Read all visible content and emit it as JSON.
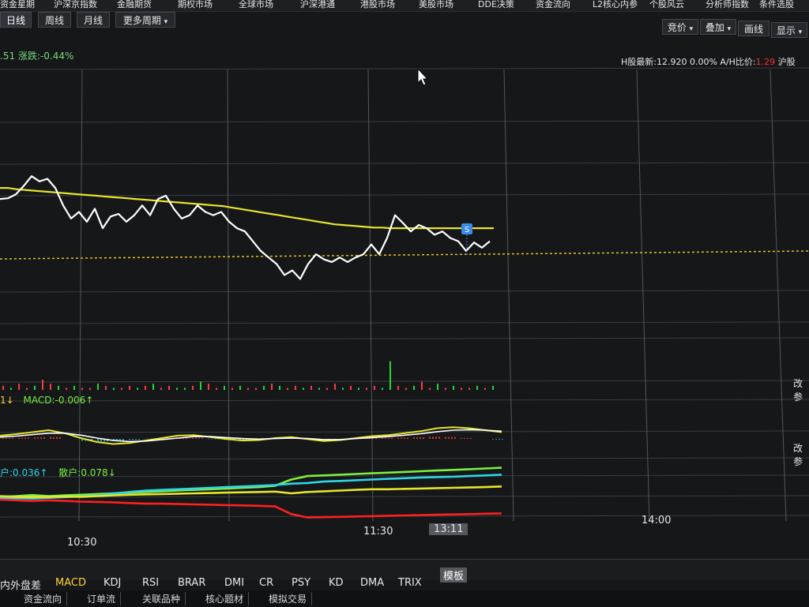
{
  "menu": {
    "items": [
      "资金星期",
      "沪深京指数",
      "金融期货",
      "期权市场",
      "全球市场",
      "沪深港通",
      "港股市场",
      "美股市场",
      "DDE决策",
      "资金流向",
      "L2核心内参",
      "个股风云",
      "分析师指数",
      "条件选股"
    ]
  },
  "period_buttons": [
    "日线",
    "周线",
    "月线",
    "更多周期"
  ],
  "tool_buttons": [
    "竞价",
    "叠加",
    "画线",
    "显示"
  ],
  "price_info": {
    "left_value": ".51",
    "change_label": "涨跌:-0.44%",
    "h_share": "H股最新:12.920",
    "h_change": "0.00%",
    "ah_label": "A/H比价:",
    "ah_value": "1.29",
    "market": "沪股"
  },
  "indicators": {
    "macd_label": "MACD:-0.006",
    "macd_prefix": "1",
    "fund_a": "户:0.036",
    "fund_b": "散户:0.078",
    "side_label_1": "改参",
    "side_label_2": "改参"
  },
  "marker": {
    "label": "S"
  },
  "time_axis": {
    "labels": [
      "10:30",
      "11:30",
      "13:11",
      "14:00"
    ]
  },
  "bottom_tabs": [
    "内外盘差",
    "MACD",
    "KDJ",
    "RSI",
    "BRAR",
    "DMI",
    "CR",
    "PSY",
    "KD",
    "DMA",
    "TRIX",
    "模板"
  ],
  "bottom_bar2": [
    "资金流向",
    "订单流",
    "关联品种",
    "核心题材",
    "模拟交易"
  ],
  "colors": {
    "background": "#151719",
    "price_line": "#ffffff",
    "avg_line": "#e6e62a",
    "up": "#ff3b3b",
    "down": "#26d43b",
    "fund_green": "#7cf040",
    "fund_cyan": "#2fd6e6",
    "fund_yellow": "#e6e62a",
    "fund_red": "#ff2020"
  },
  "chart_data": [
    {
      "type": "line",
      "x": [
        0,
        10,
        20,
        30,
        40,
        50,
        60,
        70,
        80,
        90,
        100,
        110,
        120,
        130,
        140,
        150,
        160,
        170,
        180,
        190,
        200,
        210,
        220,
        230,
        240,
        250,
        260,
        270,
        280,
        290,
        300,
        310,
        320,
        330,
        340,
        350,
        360,
        370,
        380,
        390,
        400,
        410,
        420,
        430,
        440,
        450,
        460,
        470,
        480,
        490,
        500,
        510,
        520,
        530,
        540,
        550,
        560,
        570,
        580,
        590,
        600,
        610,
        620
      ],
      "series": [
        {
          "values": [
            0.55,
            0.56,
            0.62,
            0.75,
            0.9,
            0.82,
            0.86,
            0.72,
            0.45,
            0.25,
            0.35,
            0.2,
            0.4,
            0.1,
            0.28,
            0.32,
            0.2,
            0.3,
            0.45,
            0.3,
            0.55,
            0.6,
            0.4,
            0.25,
            0.3,
            0.45,
            0.35,
            0.3,
            0.35,
            0.2,
            0.1,
            0.05,
            -0.1,
            -0.25,
            -0.35,
            -0.45,
            -0.62,
            -0.55,
            -0.68,
            -0.45,
            -0.3,
            -0.38,
            -0.42,
            -0.35,
            -0.42,
            -0.35,
            -0.3,
            -0.15,
            -0.3,
            -0.05,
            0.3,
            0.18,
            0.05,
            0.15,
            0.1,
            0.0,
            0.05,
            -0.05,
            -0.1,
            -0.25,
            -0.12,
            -0.2,
            -0.1
          ]
        },
        {
          "values": [
            0.72,
            0.72,
            0.7,
            0.69,
            0.68,
            0.67,
            0.66,
            0.65,
            0.64,
            0.63,
            0.62,
            0.61,
            0.6,
            0.59,
            0.58,
            0.57,
            0.56,
            0.55,
            0.54,
            0.53,
            0.52,
            0.51,
            0.5,
            0.49,
            0.48,
            0.47,
            0.46,
            0.45,
            0.44,
            0.42,
            0.4,
            0.38,
            0.36,
            0.34,
            0.32,
            0.3,
            0.28,
            0.26,
            0.24,
            0.22,
            0.2,
            0.18,
            0.16,
            0.15,
            0.14,
            0.13,
            0.12,
            0.11,
            0.11,
            0.1,
            0.1,
            0.1,
            0.1,
            0.1,
            0.1,
            0.1,
            0.1,
            0.1,
            0.1,
            0.1,
            0.1,
            0.1,
            0.1
          ]
        }
      ]
    },
    {
      "type": "bar",
      "values": [
        2,
        1,
        3,
        1,
        2,
        5,
        3,
        2,
        1,
        2,
        1,
        1,
        3,
        2,
        1,
        1,
        2,
        1,
        2,
        3,
        1,
        2,
        1,
        1,
        2,
        4,
        3,
        1,
        2,
        1,
        2,
        1,
        1,
        2,
        3,
        2,
        1,
        2,
        1,
        2,
        1,
        1,
        3,
        1,
        2,
        1,
        1,
        2,
        1,
        14,
        2,
        1,
        2,
        4,
        1,
        3,
        1,
        2,
        1,
        1,
        2,
        1,
        2
      ],
      "up": [
        true,
        false,
        true,
        true,
        false,
        true,
        true,
        false,
        true,
        false,
        true,
        true,
        false,
        true,
        false,
        true,
        true,
        false,
        true,
        false,
        true,
        true,
        false,
        false,
        true,
        false,
        true,
        true,
        false,
        true,
        false,
        true,
        true,
        false,
        true,
        false,
        true,
        true,
        false,
        true,
        false,
        true,
        true,
        false,
        true,
        false,
        true,
        true,
        false,
        false,
        true,
        true,
        false,
        true,
        true,
        false,
        true,
        false,
        true,
        true,
        false,
        true,
        false
      ]
    },
    {
      "type": "line",
      "series": [
        {
          "values": [
            0.05,
            0.08,
            0.12,
            0.16,
            0.1,
            0.0,
            -0.08,
            -0.12,
            -0.1,
            -0.05,
            0.0,
            0.05,
            0.06,
            0.02,
            -0.02,
            -0.05,
            -0.04,
            0.0,
            0.02,
            -0.02,
            -0.06,
            -0.04,
            0.0,
            0.04,
            0.06,
            0.1,
            0.14,
            0.2,
            0.22,
            0.2,
            0.16,
            0.12
          ]
        },
        {
          "values": [
            0.02,
            0.04,
            0.07,
            0.1,
            0.1,
            0.06,
            0.0,
            -0.05,
            -0.07,
            -0.06,
            -0.03,
            0.0,
            0.03,
            0.03,
            0.01,
            -0.01,
            -0.02,
            -0.01,
            0.0,
            -0.01,
            -0.03,
            -0.03,
            -0.01,
            0.01,
            0.03,
            0.06,
            0.09,
            0.13,
            0.16,
            0.17,
            0.16,
            0.14
          ]
        }
      ]
    },
    {
      "type": "line",
      "series": [
        {
          "values": [
            0.1,
            0.12,
            0.15,
            0.12,
            0.14,
            0.16,
            0.18,
            0.2,
            0.22,
            0.24,
            0.26,
            0.28,
            0.3,
            0.32,
            0.34,
            0.36,
            0.38,
            0.42,
            0.6,
            0.7,
            0.72,
            0.74,
            0.76,
            0.78,
            0.8,
            0.82,
            0.84,
            0.86,
            0.88,
            0.9,
            0.92,
            0.94
          ]
        },
        {
          "values": [
            0.05,
            0.06,
            0.05,
            0.07,
            0.09,
            0.11,
            0.14,
            0.2,
            0.24,
            0.28,
            0.3,
            0.32,
            0.34,
            0.36,
            0.38,
            0.4,
            0.42,
            0.44,
            0.48,
            0.5,
            0.54,
            0.56,
            0.58,
            0.6,
            0.62,
            0.64,
            0.66,
            0.67,
            0.68,
            0.7,
            0.72,
            0.74
          ]
        },
        {
          "values": [
            0.12,
            0.1,
            0.09,
            0.1,
            0.11,
            0.1,
            0.12,
            0.14,
            0.16,
            0.17,
            0.18,
            0.19,
            0.2,
            0.21,
            0.22,
            0.23,
            0.24,
            0.25,
            0.2,
            0.24,
            0.26,
            0.28,
            0.3,
            0.32,
            0.32,
            0.33,
            0.34,
            0.35,
            0.36,
            0.37,
            0.38,
            0.4
          ]
        },
        {
          "values": [
            0.02,
            0.0,
            -0.02,
            0.0,
            -0.02,
            -0.04,
            -0.05,
            -0.06,
            -0.08,
            -0.1,
            -0.1,
            -0.11,
            -0.12,
            -0.13,
            -0.14,
            -0.15,
            -0.16,
            -0.18,
            -0.4,
            -0.5,
            -0.49,
            -0.48,
            -0.47,
            -0.46,
            -0.45,
            -0.44,
            -0.43,
            -0.42,
            -0.41,
            -0.4,
            -0.39,
            -0.38
          ]
        }
      ]
    }
  ]
}
